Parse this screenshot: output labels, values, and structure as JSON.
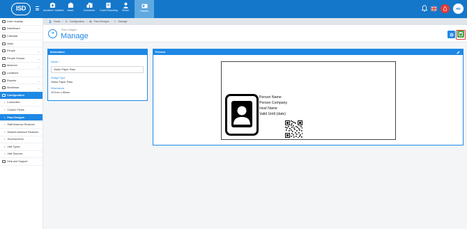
{
  "app": {
    "logo_text": "ISD"
  },
  "nav": [
    {
      "label": "Accident / Incident",
      "icon": "accident-icon",
      "active": false
    },
    {
      "label": "Asset",
      "icon": "asset-icon",
      "active": false
    },
    {
      "label": "Contractor",
      "icon": "contractor-icon",
      "active": false
    },
    {
      "label": "Covid Reporting",
      "icon": "covid-icon",
      "active": false
    },
    {
      "label": "Visitor",
      "icon": "visitor-icon",
      "active": false
    },
    {
      "label": "Passes",
      "icon": "passes-icon",
      "active": true
    }
  ],
  "user": {
    "initials": "HD"
  },
  "breadcrumb": [
    "Home",
    "Configuration",
    "Pass Designs",
    "Manage"
  ],
  "sidebar": [
    {
      "label": "Learn Isoplay",
      "icon": "learn-icon",
      "type": "item"
    },
    {
      "label": "Dashboard",
      "icon": "dashboard-icon",
      "type": "item"
    },
    {
      "label": "Calendar",
      "icon": "calendar-icon",
      "type": "item"
    },
    {
      "label": "Visits",
      "icon": "visits-icon",
      "type": "item"
    },
    {
      "label": "People",
      "icon": "people-icon",
      "type": "item",
      "chevron": true
    },
    {
      "label": "People Groups",
      "icon": "people-groups-icon",
      "type": "item",
      "chevron": true
    },
    {
      "label": "Absence",
      "icon": "absence-icon",
      "type": "item",
      "chevron": true
    },
    {
      "label": "Locations",
      "icon": "locations-icon",
      "type": "item"
    },
    {
      "label": "Reports",
      "icon": "reports-icon",
      "type": "item",
      "chevron": true
    },
    {
      "label": "Workflows",
      "icon": "workflows-icon",
      "type": "item",
      "chevron": true
    },
    {
      "label": "Configuration",
      "icon": "configuration-icon",
      "type": "item",
      "active": true
    },
    {
      "label": "Lockouties",
      "type": "sub"
    },
    {
      "label": "Custom Fields",
      "type": "sub"
    },
    {
      "label": "Pass Designs",
      "type": "sub",
      "active": true
    },
    {
      "label": "Staff Absence Reasons",
      "type": "sub"
    },
    {
      "label": "Student Absence Reasons",
      "type": "sub"
    },
    {
      "label": "Touchscreens",
      "type": "sub"
    },
    {
      "label": "Visit Types",
      "type": "sub"
    },
    {
      "label": "Visit Sources",
      "type": "sub"
    },
    {
      "label": "Help and Support",
      "icon": "help-icon",
      "type": "item"
    }
  ],
  "page": {
    "supertitle": "Pass Designs",
    "title": "Manage"
  },
  "info_panel": {
    "title": "Information",
    "name_label": "Name",
    "name_value": "Visitor Paper Pass",
    "design_type_label": "Design Type",
    "design_type_value": "Visitor Paper Pass",
    "dimensions_label": "Dimensions",
    "dimensions_value": "107mm x 85mm"
  },
  "preview_panel": {
    "title": "Preview",
    "lines": [
      "Person Name",
      "Person Company",
      "Host Name",
      "Valid Until (date)"
    ]
  },
  "colors": {
    "primary": "#1577c9",
    "accent": "#1e88e5",
    "danger": "#e53935",
    "success": "#43a047"
  }
}
